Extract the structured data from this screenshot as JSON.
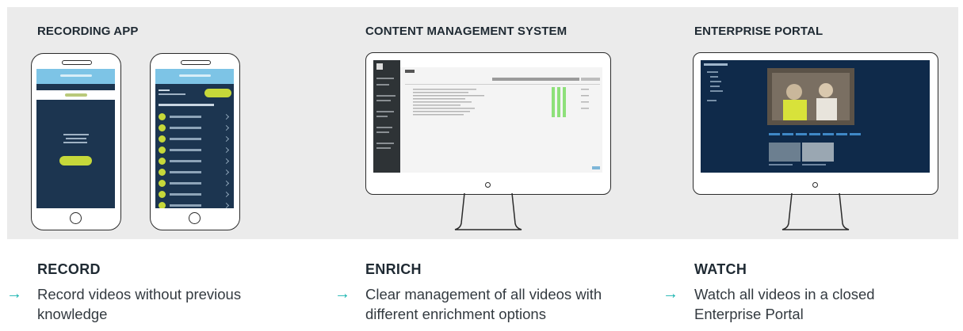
{
  "sections": [
    {
      "title": "RECORDING APP",
      "step": "RECORD",
      "description": "Record videos without  previous knowledge"
    },
    {
      "title": "CONTENT MANAGEMENT SYSTEM",
      "step": "ENRICH",
      "description": "Clear management of all videos with different enrichment options"
    },
    {
      "title": "ENTERPRISE PORTAL",
      "step": "WATCH",
      "description": "Watch all videos in a closed Enterprise Portal"
    }
  ],
  "arrow_glyph": "→",
  "colors": {
    "band": "#ebebeb",
    "accent_arrow": "#19b5b0",
    "app_screen": "#1c3550",
    "app_header": "#7dc4e6",
    "app_button": "#c6d83a",
    "cms_progress": "#8ee07a",
    "portal_bg": "#0f2a4a"
  },
  "icons": [
    "arrow-right-icon",
    "smartphone-icon",
    "monitor-icon"
  ]
}
